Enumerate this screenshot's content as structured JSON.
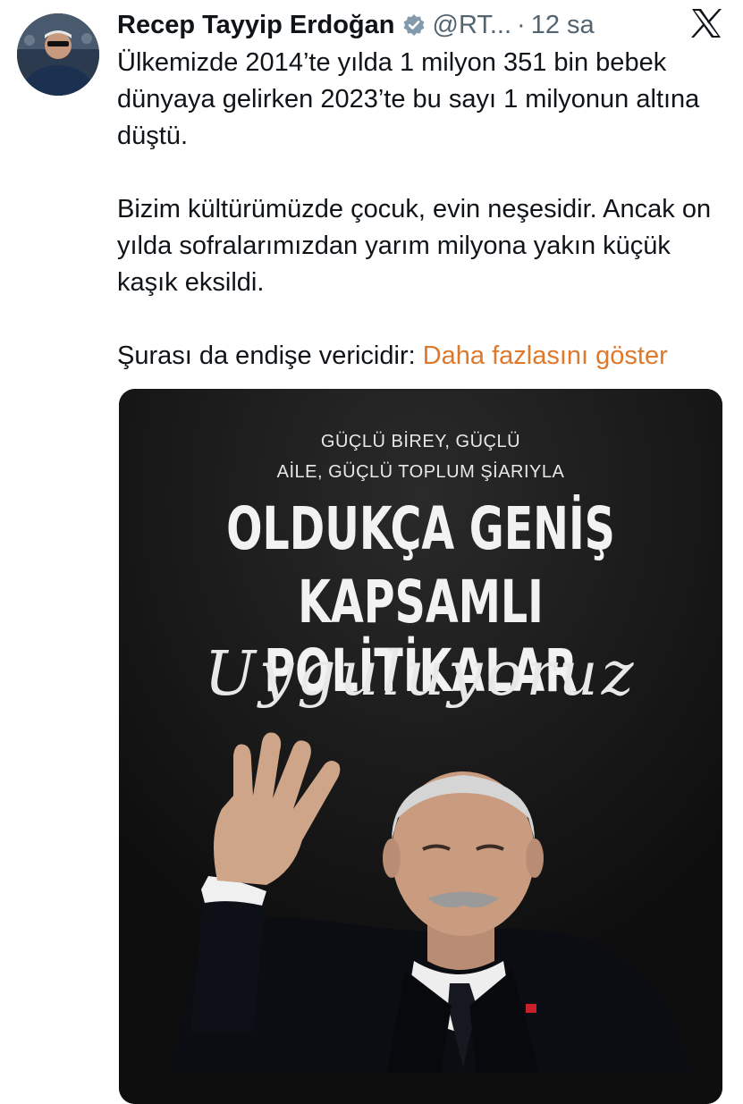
{
  "tweet": {
    "author_name": "Recep Tayyip Erdoğan",
    "handle": "@RT...",
    "separator": "·",
    "time": "12 sa",
    "paragraphs": [
      "Ülkemizde 2014’te yılda 1 milyon 351 bin bebek dünyaya gelirken 2023’te bu sayı 1 milyonun altına düştü.",
      "Bizim kültürümüzde çocuk, evin neşesidir. Ancak on yılda sofralarımızdan yarım milyona yakın küçük kaşık eksildi."
    ],
    "last_line": "Şurası da endişe vericidir:",
    "show_more": "Daha fazlasını göster"
  },
  "media": {
    "kicker_line1": "GÜÇLÜ BİREY, GÜÇLÜ",
    "kicker_line2": "AİLE, GÜÇLÜ TOPLUM ŞİARIYLA",
    "headline_line1": "OLDUKÇA GENİŞ",
    "headline_line2": "KAPSAMLI POLİTİKALAR",
    "script_word": "Uyguluyoruz"
  },
  "icons": {
    "verified": "verified-badge-icon",
    "x_logo": "x-logo-icon"
  },
  "colors": {
    "text": "#0f1419",
    "secondary": "#536471",
    "link": "#e0782a",
    "media_bg": "#121212"
  }
}
